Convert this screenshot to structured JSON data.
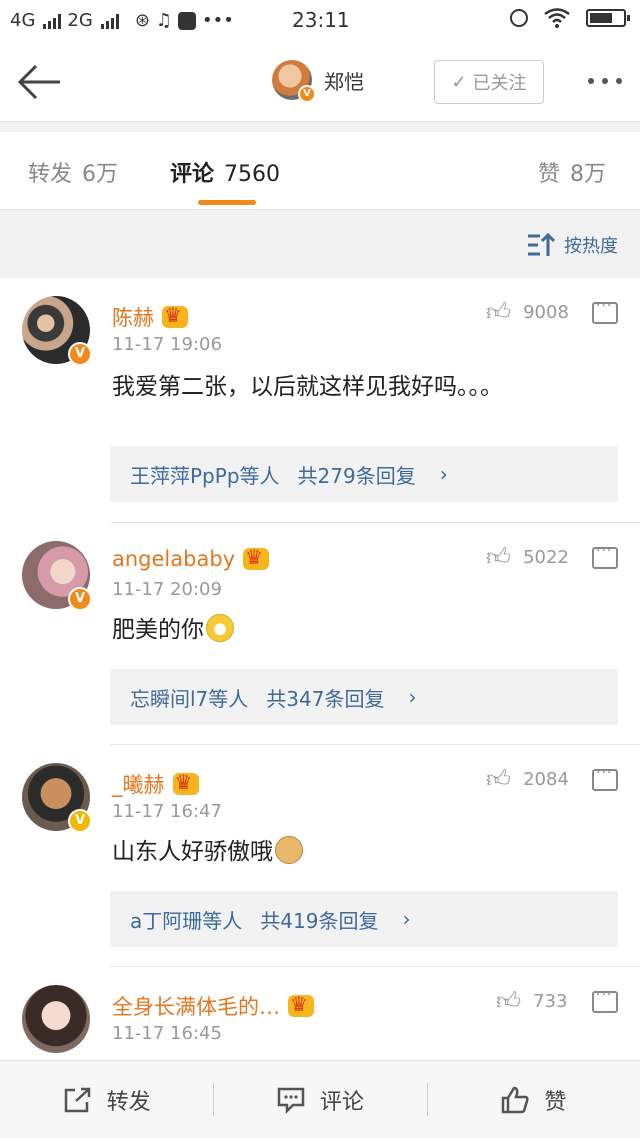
{
  "status_bar": {
    "net1": "4G",
    "net2": "2G",
    "time": "23:11",
    "icons": [
      "signal-icon",
      "weibo-icon",
      "music-icon",
      "app-icon",
      "more-dots-icon",
      "alarm-icon",
      "wifi-icon",
      "battery-icon"
    ]
  },
  "header": {
    "user_name": "郑恺",
    "follow_label": "已关注"
  },
  "tabs": [
    {
      "label": "转发",
      "count": "6万"
    },
    {
      "label": "评论",
      "count": "7560"
    },
    {
      "label": "赞",
      "count": "8万"
    }
  ],
  "sort": {
    "label": "按热度"
  },
  "comments": [
    {
      "name": "陈赫",
      "time": "11-17 19:06",
      "likes": "9008",
      "text": "我爱第二张，以后就这样见我好吗。。。",
      "reply_users": "王萍萍PpPp等人",
      "reply_count": "共279条回复"
    },
    {
      "name": "angelababy",
      "time": "11-17 20:09",
      "likes": "5022",
      "text": "肥美的你",
      "reply_users": "忘瞬间l7等人",
      "reply_count": "共347条回复"
    },
    {
      "name": "_曦赫",
      "time": "11-17 16:47",
      "likes": "2084",
      "text": "山东人好骄傲哦",
      "reply_users": "a丁阿珊等人",
      "reply_count": "共419条回复"
    },
    {
      "name": "全身长满体毛的…",
      "time": "11-17 16:45",
      "likes": "733"
    }
  ],
  "bottom_bar": {
    "repost": "转发",
    "comment": "评论",
    "like": "赞"
  },
  "colors": {
    "accent": "#f08a1a",
    "link": "#3d6a9a",
    "name": "#e2771f"
  }
}
